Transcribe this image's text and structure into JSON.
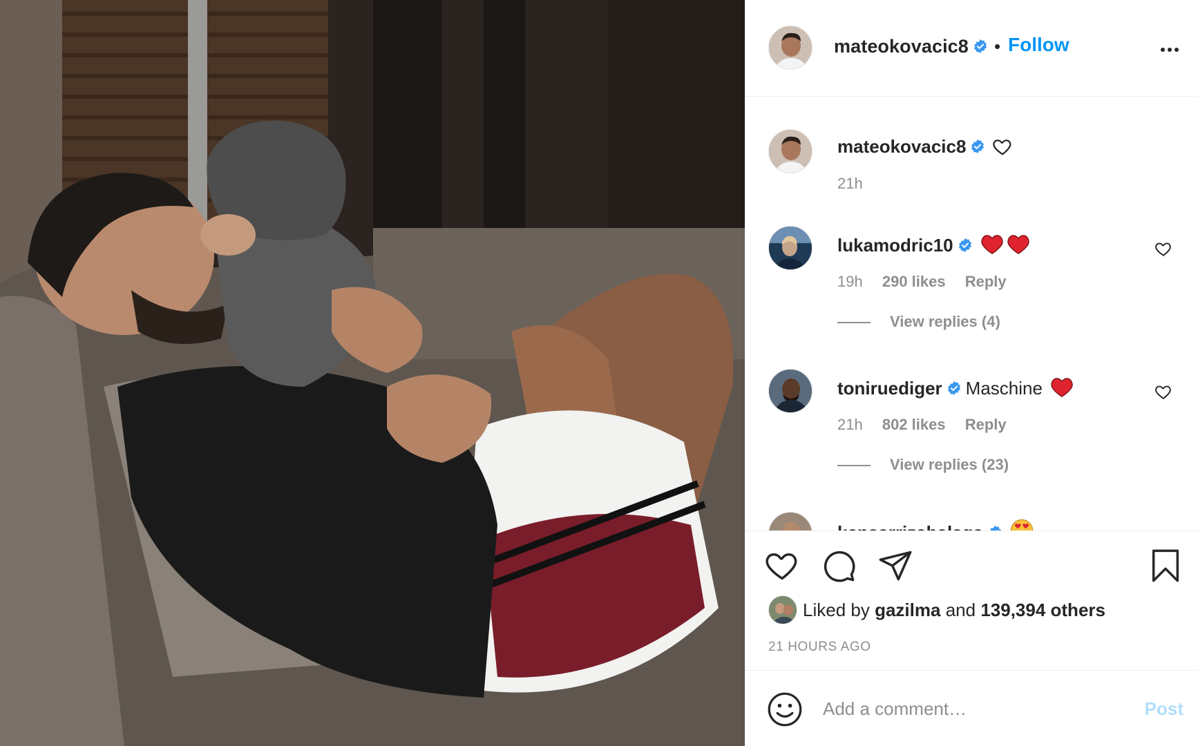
{
  "post": {
    "author": {
      "username": "mateokovacic8",
      "verified": true,
      "follow_label": "Follow",
      "separator": "•"
    },
    "caption": {
      "username": "mateokovacic8",
      "time": "21h"
    },
    "comments": [
      {
        "username": "lukamodric10",
        "text": "",
        "emoji": [
          "red-heart",
          "red-heart"
        ],
        "time": "19h",
        "likes": "290 likes",
        "reply_label": "Reply",
        "view_replies": "View replies (4)"
      },
      {
        "username": "toniruediger",
        "text": "Maschine",
        "emoji": [
          "red-heart"
        ],
        "time": "21h",
        "likes": "802 likes",
        "reply_label": "Reply",
        "view_replies": "View replies (23)"
      },
      {
        "username": "kepaarrizabalaga",
        "text": "",
        "emoji": [
          "heart-eyes"
        ],
        "time": "",
        "likes": "",
        "reply_label": "",
        "view_replies": ""
      }
    ],
    "likes": {
      "prefix": "Liked by",
      "by_user": "gazilma",
      "joiner": "and",
      "others": "139,394 others"
    },
    "time_ago": "21 HOURS AGO",
    "add_comment": {
      "placeholder": "Add a comment…",
      "post_label": "Post"
    }
  },
  "colors": {
    "link_blue": "#0095f6",
    "post_disabled": "#b2dffc",
    "muted": "#8e8e8e",
    "verified_blue": "#3897f0",
    "heart_red": "#ed4956"
  },
  "icons": [
    "verified-badge-icon",
    "more-options-icon",
    "heart-icon",
    "comment-icon",
    "share-icon",
    "bookmark-icon",
    "emoji-icon"
  ]
}
